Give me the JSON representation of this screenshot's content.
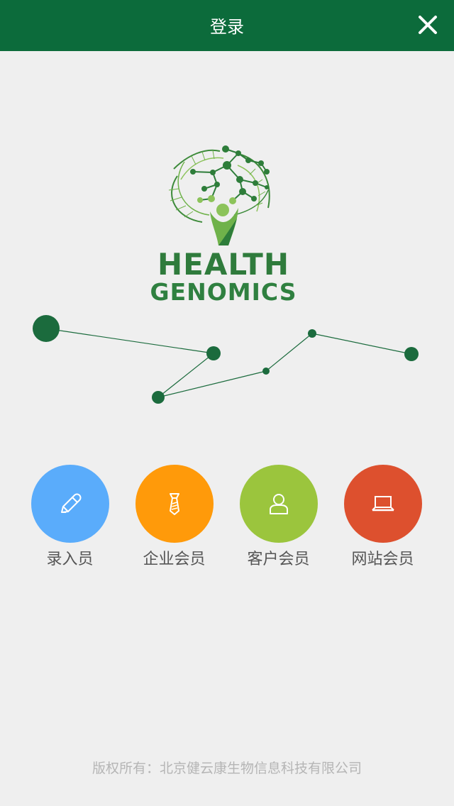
{
  "header": {
    "title": "登录",
    "close_icon": "close-icon"
  },
  "logo": {
    "line1": "HEALTH",
    "line2": "GENOMICS",
    "icon": "dna-tree-icon"
  },
  "roles": [
    {
      "label": "录入员",
      "color": "#5aacfb",
      "icon": "pencil-icon"
    },
    {
      "label": "企业会员",
      "color": "#ff9a0a",
      "icon": "necktie-icon"
    },
    {
      "label": "客户会员",
      "color": "#9bc53d",
      "icon": "user-icon"
    },
    {
      "label": "网站会员",
      "color": "#dd502e",
      "icon": "laptop-icon"
    }
  ],
  "footer": {
    "copyright": "版权所有：北京健云康生物信息科技有限公司"
  },
  "colors": {
    "primary": "#0c6b3b",
    "background": "#efefef"
  }
}
